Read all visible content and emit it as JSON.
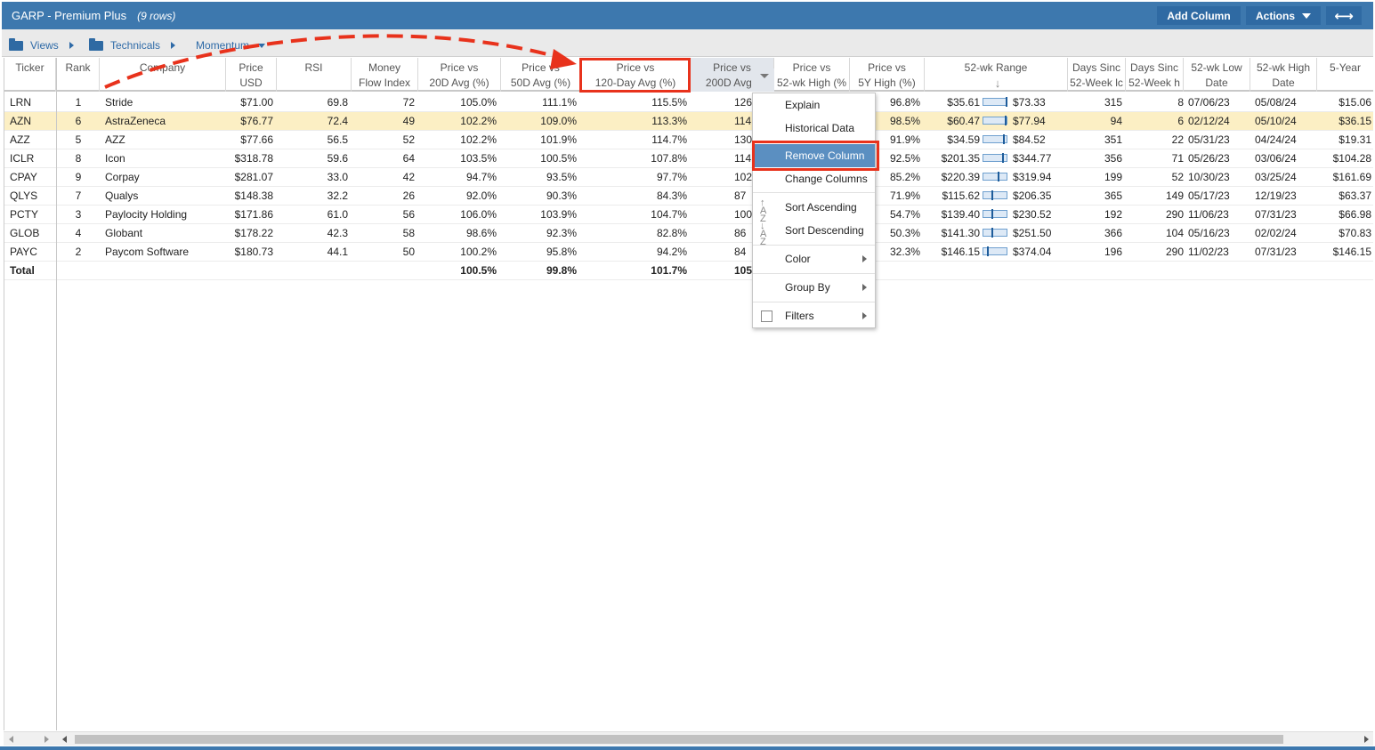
{
  "window": {
    "title": "GARP - Premium Plus",
    "rows_label": "(9 rows)",
    "add_column_label": "Add Column",
    "actions_label": "Actions",
    "expand_icon": "expand-horizontal-icon"
  },
  "breadcrumb": {
    "views": "Views",
    "technicals": "Technicals",
    "momentum": "Momentum"
  },
  "columns": [
    {
      "l1": "Ticker",
      "l2": ""
    },
    {
      "l1": "Rank",
      "l2": ""
    },
    {
      "l1": "Company",
      "l2": ""
    },
    {
      "l1": "Price",
      "l2": "USD"
    },
    {
      "l1": "RSI",
      "l2": ""
    },
    {
      "l1": "Money",
      "l2": "Flow Index"
    },
    {
      "l1": "Price vs",
      "l2": "20D Avg (%)"
    },
    {
      "l1": "Price vs",
      "l2": "50D Avg (%)"
    },
    {
      "l1": "Price vs",
      "l2": "120-Day Avg (%)"
    },
    {
      "l1": "Price vs",
      "l2": "200D Avg ("
    },
    {
      "l1": "Price vs",
      "l2": "52-wk High (%"
    },
    {
      "l1": "Price vs",
      "l2": "5Y High (%)"
    },
    {
      "l1": "52-wk Range",
      "l2": ""
    },
    {
      "l1": "Days Sinc",
      "l2": "52-Week lc"
    },
    {
      "l1": "Days Sinc",
      "l2": "52-Week h"
    },
    {
      "l1": "52-wk Low",
      "l2": "Date"
    },
    {
      "l1": "52-wk High",
      "l2": "Date"
    },
    {
      "l1": "5-Year",
      "l2": ""
    }
  ],
  "rows": [
    {
      "ticker": "LRN",
      "rank": "1",
      "company": "Stride",
      "price": "$71.00",
      "rsi": "69.8",
      "mfi": "72",
      "p20": "105.0%",
      "p50": "111.1%",
      "p120": "115.5%",
      "p200": "126",
      "p52h": "96.8%",
      "p5y": "96.8%",
      "low": "$35.61",
      "high": "$73.33",
      "marker": 0.95,
      "dlow": "315",
      "dhigh": "8",
      "lowdate": "07/06/23",
      "highdate": "05/08/24",
      "y5": "$15.06",
      "highlight": false
    },
    {
      "ticker": "AZN",
      "rank": "6",
      "company": "AstraZeneca",
      "price": "$76.77",
      "rsi": "72.4",
      "mfi": "49",
      "p20": "102.2%",
      "p50": "109.0%",
      "p120": "113.3%",
      "p200": "114",
      "p52h": "98.5%",
      "p5y": "98.5%",
      "low": "$60.47",
      "high": "$77.94",
      "marker": 0.94,
      "dlow": "94",
      "dhigh": "6",
      "lowdate": "02/12/24",
      "highdate": "05/10/24",
      "y5": "$36.15",
      "highlight": true
    },
    {
      "ticker": "AZZ",
      "rank": "5",
      "company": "AZZ",
      "price": "$77.66",
      "rsi": "56.5",
      "mfi": "52",
      "p20": "102.2%",
      "p50": "101.9%",
      "p120": "114.7%",
      "p200": "130",
      "p52h": "91.9%",
      "p5y": "91.9%",
      "low": "$34.59",
      "high": "$84.52",
      "marker": 0.86,
      "dlow": "351",
      "dhigh": "22",
      "lowdate": "05/31/23",
      "highdate": "04/24/24",
      "y5": "$19.31",
      "highlight": false
    },
    {
      "ticker": "ICLR",
      "rank": "8",
      "company": "Icon",
      "price": "$318.78",
      "rsi": "59.6",
      "mfi": "64",
      "p20": "103.5%",
      "p50": "100.5%",
      "p120": "107.8%",
      "p200": "114",
      "p52h": "92.5%",
      "p5y": "92.5%",
      "low": "$201.35",
      "high": "$344.77",
      "marker": 0.82,
      "dlow": "356",
      "dhigh": "71",
      "lowdate": "05/26/23",
      "highdate": "03/06/24",
      "y5": "$104.28",
      "highlight": false
    },
    {
      "ticker": "CPAY",
      "rank": "9",
      "company": "Corpay",
      "price": "$281.07",
      "rsi": "33.0",
      "mfi": "42",
      "p20": "94.7%",
      "p50": "93.5%",
      "p120": "97.7%",
      "p200": "102",
      "p52h": "85.2%",
      "p5y": "85.2%",
      "low": "$220.39",
      "high": "$319.94",
      "marker": 0.61,
      "dlow": "199",
      "dhigh": "52",
      "lowdate": "10/30/23",
      "highdate": "03/25/24",
      "y5": "$161.69",
      "highlight": false
    },
    {
      "ticker": "QLYS",
      "rank": "7",
      "company": "Qualys",
      "price": "$148.38",
      "rsi": "32.2",
      "mfi": "26",
      "p20": "92.0%",
      "p50": "90.3%",
      "p120": "84.3%",
      "p200": "87",
      "p52h": "71.9%",
      "p5y": "71.9%",
      "low": "$115.62",
      "high": "$206.35",
      "marker": 0.36,
      "dlow": "365",
      "dhigh": "149",
      "lowdate": "05/17/23",
      "highdate": "12/19/23",
      "y5": "$63.37",
      "highlight": false
    },
    {
      "ticker": "PCTY",
      "rank": "3",
      "company": "Paylocity Holding",
      "price": "$171.86",
      "rsi": "61.0",
      "mfi": "56",
      "p20": "106.0%",
      "p50": "103.9%",
      "p120": "104.7%",
      "p200": "100",
      "p52h": "54.7%",
      "p5y": "54.7%",
      "low": "$139.40",
      "high": "$230.52",
      "marker": 0.36,
      "dlow": "192",
      "dhigh": "290",
      "lowdate": "11/06/23",
      "highdate": "07/31/23",
      "y5": "$66.98",
      "highlight": false
    },
    {
      "ticker": "GLOB",
      "rank": "4",
      "company": "Globant",
      "price": "$178.22",
      "rsi": "42.3",
      "mfi": "58",
      "p20": "98.6%",
      "p50": "92.3%",
      "p120": "82.8%",
      "p200": "86",
      "p52h": "50.3%",
      "p5y": "50.3%",
      "low": "$141.30",
      "high": "$251.50",
      "marker": 0.33,
      "dlow": "366",
      "dhigh": "104",
      "lowdate": "05/16/23",
      "highdate": "02/02/24",
      "y5": "$70.83",
      "highlight": false
    },
    {
      "ticker": "PAYC",
      "rank": "2",
      "company": "Paycom Software",
      "price": "$180.73",
      "rsi": "44.1",
      "mfi": "50",
      "p20": "100.2%",
      "p50": "95.8%",
      "p120": "94.2%",
      "p200": "84",
      "p52h": "32.3%",
      "p5y": "32.3%",
      "low": "$146.15",
      "high": "$374.04",
      "marker": 0.14,
      "dlow": "196",
      "dhigh": "290",
      "lowdate": "11/02/23",
      "highdate": "07/31/23",
      "y5": "$146.15",
      "highlight": false
    }
  ],
  "total": {
    "label": "Total",
    "p20": "100.5%",
    "p50": "99.8%",
    "p120": "101.7%",
    "p200": "105"
  },
  "context_menu": {
    "explain": "Explain",
    "historical": "Historical Data",
    "remove": "Remove Column",
    "change": "Change Columns",
    "sort_asc": "Sort Ascending",
    "sort_desc": "Sort Descending",
    "color": "Color",
    "group_by": "Group By",
    "filters": "Filters"
  },
  "colors": {
    "header_blue": "#3d78ae",
    "highlight_row": "#fcefc4",
    "menu_active": "#5b8fc1",
    "annotation_red": "#e8321c"
  }
}
